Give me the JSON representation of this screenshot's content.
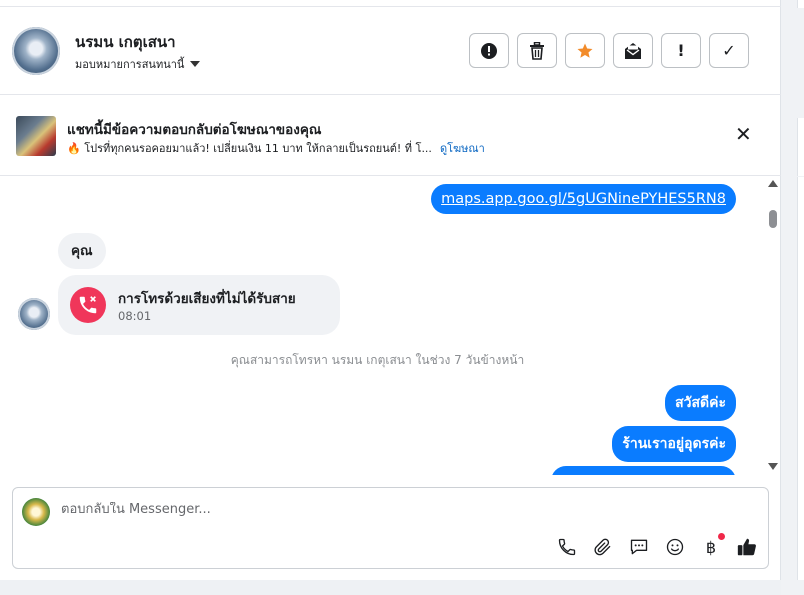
{
  "header": {
    "contact_name": "นรมน เกตุเสนา",
    "assign_label": "มอบหมายการสนทนานี้",
    "actions": [
      {
        "name": "report-spam-icon"
      },
      {
        "name": "trash-icon"
      },
      {
        "name": "star-icon"
      },
      {
        "name": "mark-unread-icon"
      },
      {
        "name": "follow-up-icon",
        "label": "!"
      },
      {
        "name": "done-icon",
        "label": "✓"
      }
    ]
  },
  "banner": {
    "title": "แชทนี้มีข้อความตอบกลับต่อโฆษณาของคุณ",
    "subtitle": "🔥 โปรที่ทุกคนรอคอยมาแล้ว! เปลี่ยนเงิน 11 บาท ให้กลายเป็นรถยนต์! ที่ โ...",
    "link": "ดูโฆษณา"
  },
  "chat": {
    "link_message": "maps.app.goo.gl/5gUGNinePYHES5RN8",
    "you_label": "คุณ",
    "missed_call_title": "การโทรด้วยเสียงที่ไม่ได้รับสาย",
    "missed_call_time": "08:01",
    "system_note": "คุณสามารถโทรหา นรมน เกตุเสนา ในช่วง 7 วันข้างหน้า",
    "outgoing": [
      "สวัสดีค่ะ",
      "ร้านเราอยู่อุดรค่ะ",
      ""
    ]
  },
  "composer": {
    "placeholder": "ตอบกลับใน Messenger...",
    "baht_symbol": "฿"
  },
  "colors": {
    "accent": "#0a7cff",
    "missed_call": "#f0365a",
    "star": "#f28b2a"
  }
}
